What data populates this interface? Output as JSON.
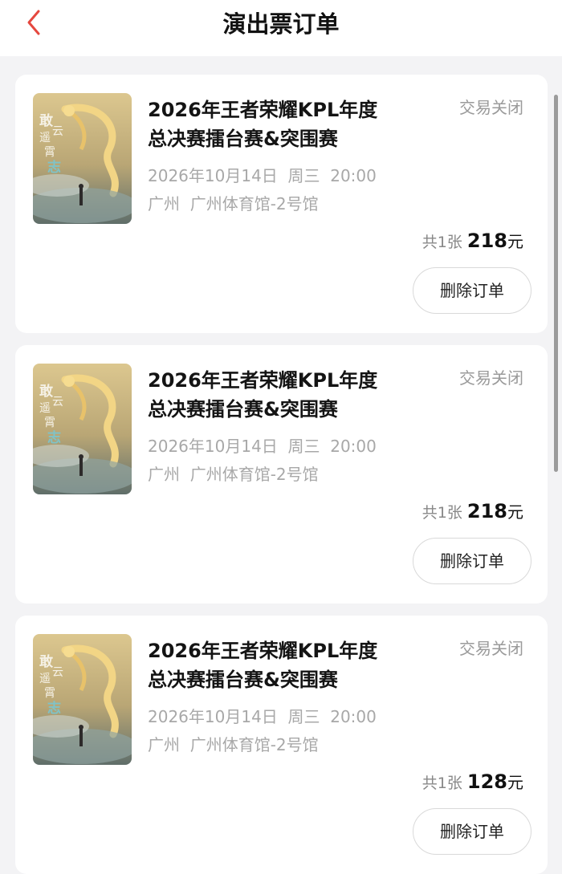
{
  "header": {
    "title": "演出票订单",
    "back_icon": "chevron-left-icon",
    "back_color": "#e5483f"
  },
  "orders": [
    {
      "title_line1": "2026年王者荣耀KPL年度",
      "title_line2": "总决赛擂台赛&突围赛",
      "status": "交易关闭",
      "datetime": "2026年10月14日  周三  20:00",
      "venue": "广州  广州体育馆-2号馆",
      "quantity": "共1张",
      "price": "218",
      "price_unit": "元",
      "delete_label": "删除订单",
      "poster_text": "敢遥云霄志"
    },
    {
      "title_line1": "2026年王者荣耀KPL年度",
      "title_line2": "总决赛擂台赛&突围赛",
      "status": "交易关闭",
      "datetime": "2026年10月14日  周三  20:00",
      "venue": "广州  广州体育馆-2号馆",
      "quantity": "共1张",
      "price": "218",
      "price_unit": "元",
      "delete_label": "删除订单",
      "poster_text": "敢遥云霄志"
    },
    {
      "title_line1": "2026年王者荣耀KPL年度",
      "title_line2": "总决赛擂台赛&突围赛",
      "status": "交易关闭",
      "datetime": "2026年10月14日  周三  20:00",
      "venue": "广州  广州体育馆-2号馆",
      "quantity": "共1张",
      "price": "128",
      "price_unit": "元",
      "delete_label": "删除订单",
      "poster_text": "敢遥云霄志"
    }
  ]
}
